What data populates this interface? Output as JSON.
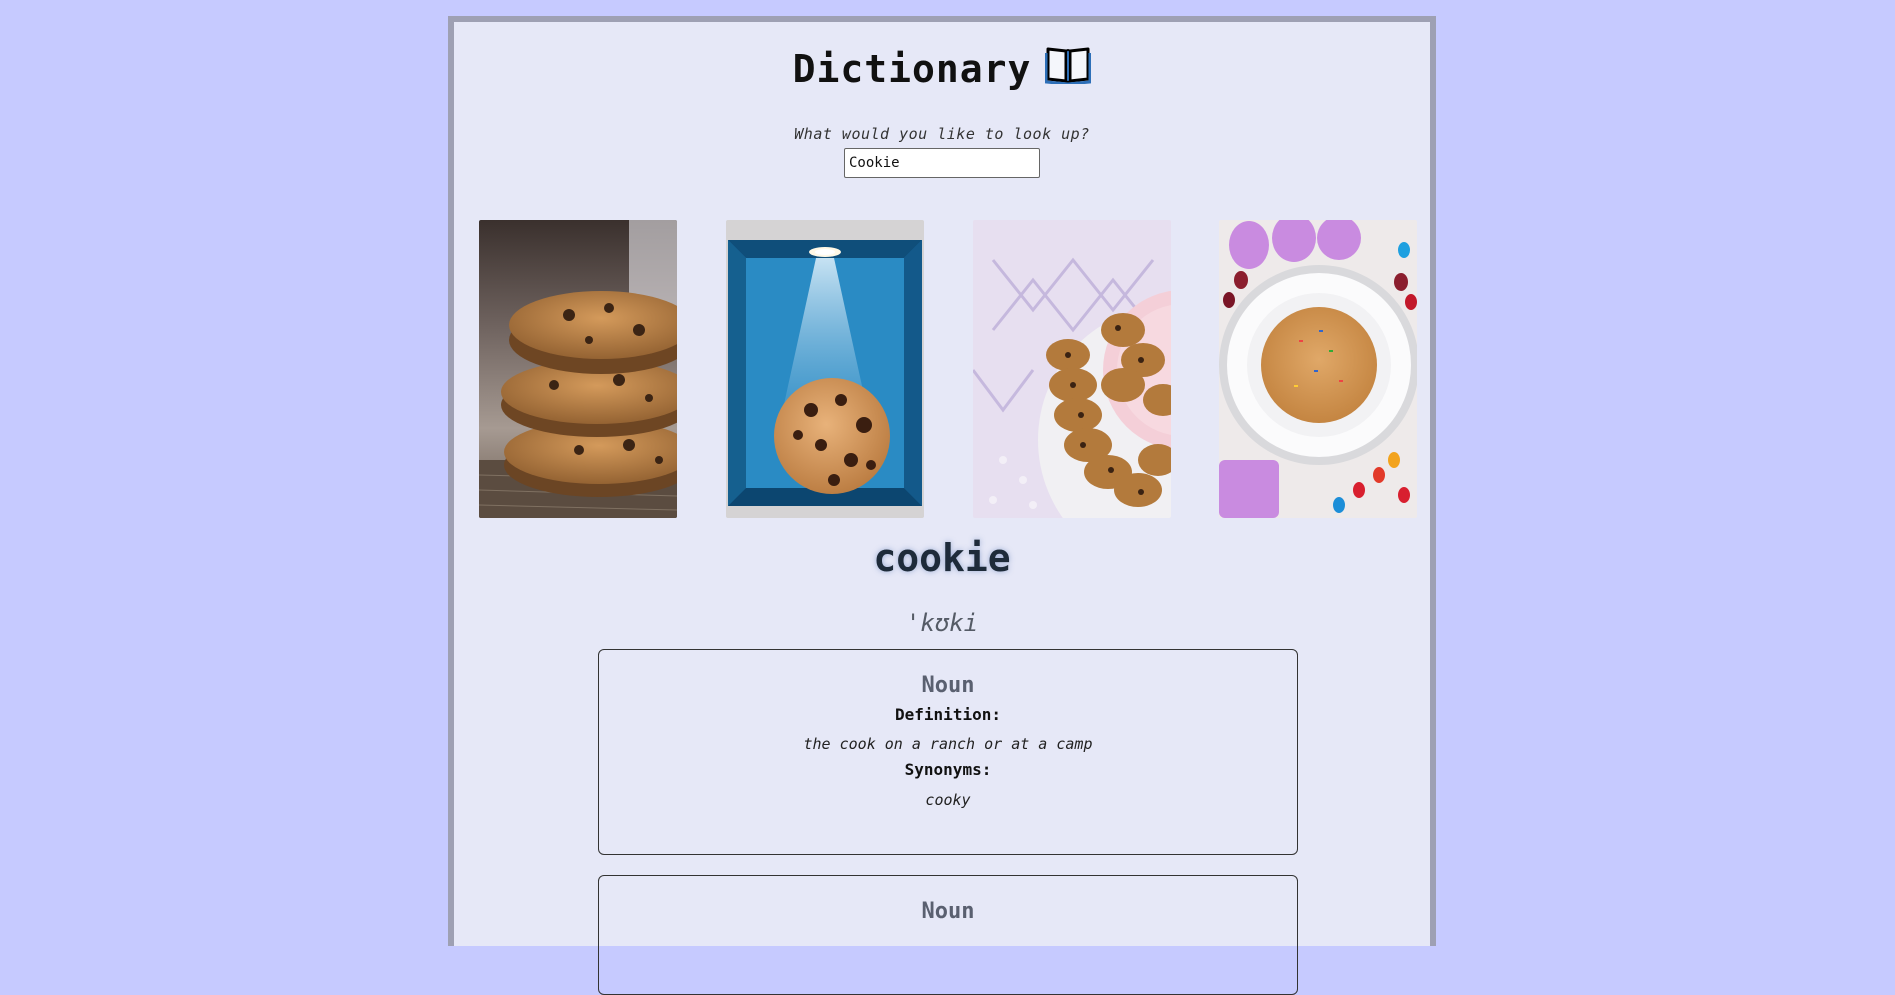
{
  "header": {
    "title": "Dictionary",
    "title_icon": "open-book-icon"
  },
  "search": {
    "label": "What would you like to look up?",
    "value": "Cookie"
  },
  "gallery": {
    "images": [
      {
        "subject": "stack of three chocolate chip cookies"
      },
      {
        "subject": "chocolate chip cookie in blue lit display box"
      },
      {
        "subject": "chocolate chip cookies on pink plate and lace cloth"
      },
      {
        "subject": "sprinkle cookie on white plate with jelly beans"
      }
    ]
  },
  "entry": {
    "word": "cookie",
    "phonetic": "'kʊki",
    "meanings": [
      {
        "part_of_speech": "Noun",
        "definition_label": "Definition:",
        "definition": "the cook on a ranch or at a camp",
        "synonyms_label": "Synonyms:",
        "synonyms": "cooky"
      },
      {
        "part_of_speech": "Noun"
      }
    ]
  },
  "colors": {
    "page_background": "#c6caff",
    "panel_background": "#e6e8f7",
    "panel_border": "#9ea0b3"
  }
}
